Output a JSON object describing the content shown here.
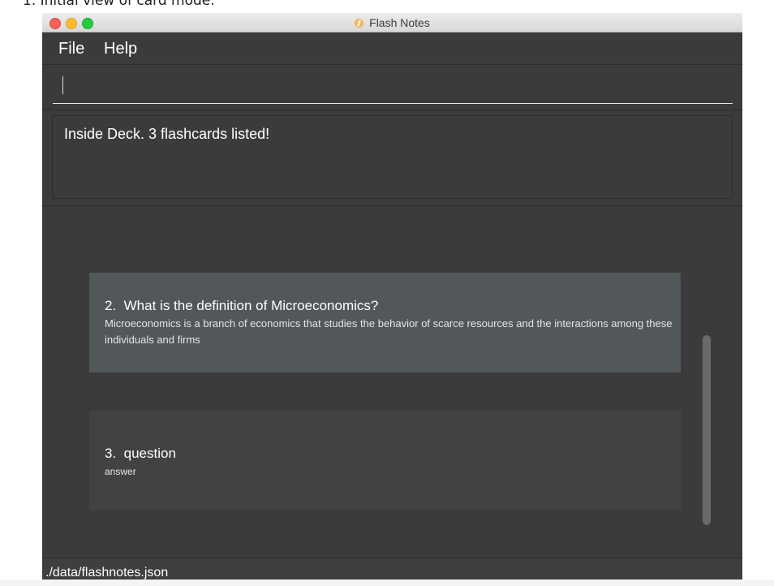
{
  "caption": "1. Initial view of card mode.",
  "window": {
    "title": "Flash Notes",
    "app_icon": "lightning-icon"
  },
  "menu": {
    "items": [
      {
        "label": "File"
      },
      {
        "label": "Help"
      }
    ]
  },
  "command_box": {
    "value": "",
    "placeholder": ""
  },
  "result_display": {
    "text": "Inside Deck. 3 flashcards listed!"
  },
  "cards": [
    {
      "index": "2.",
      "question": "What is the definition of Microeconomics?",
      "answer": "Microeconomics is a branch of economics that studies the behavior of scarce resources and the interactions among these individuals and firms"
    },
    {
      "index": "3.",
      "question": "question",
      "answer": "answer"
    }
  ],
  "status_bar": {
    "path": "./data/flashnotes.json"
  },
  "colors": {
    "background": "#3b3b3b",
    "selected_card": "#52575a",
    "card": "#424242",
    "text": "#ffffff"
  }
}
